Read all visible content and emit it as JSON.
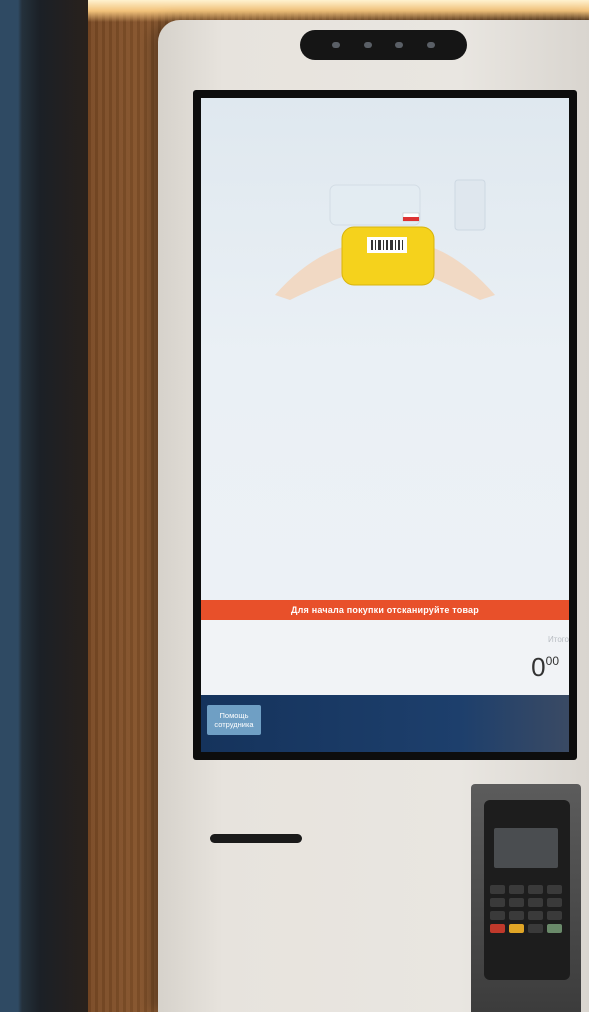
{
  "screen": {
    "banner_text": "Для начала покупки отсканируйте товар",
    "total_label": "Итого",
    "total_main": "0",
    "total_cents": "00",
    "help_button_line1": "Помощь",
    "help_button_line2": "сотрудника"
  },
  "colors": {
    "banner": "#e8502a",
    "bottom_bar": "#15335c",
    "help_button": "#6f9fc4"
  },
  "icons": [
    "hands-holding-product-illustration",
    "barcode-icon"
  ]
}
